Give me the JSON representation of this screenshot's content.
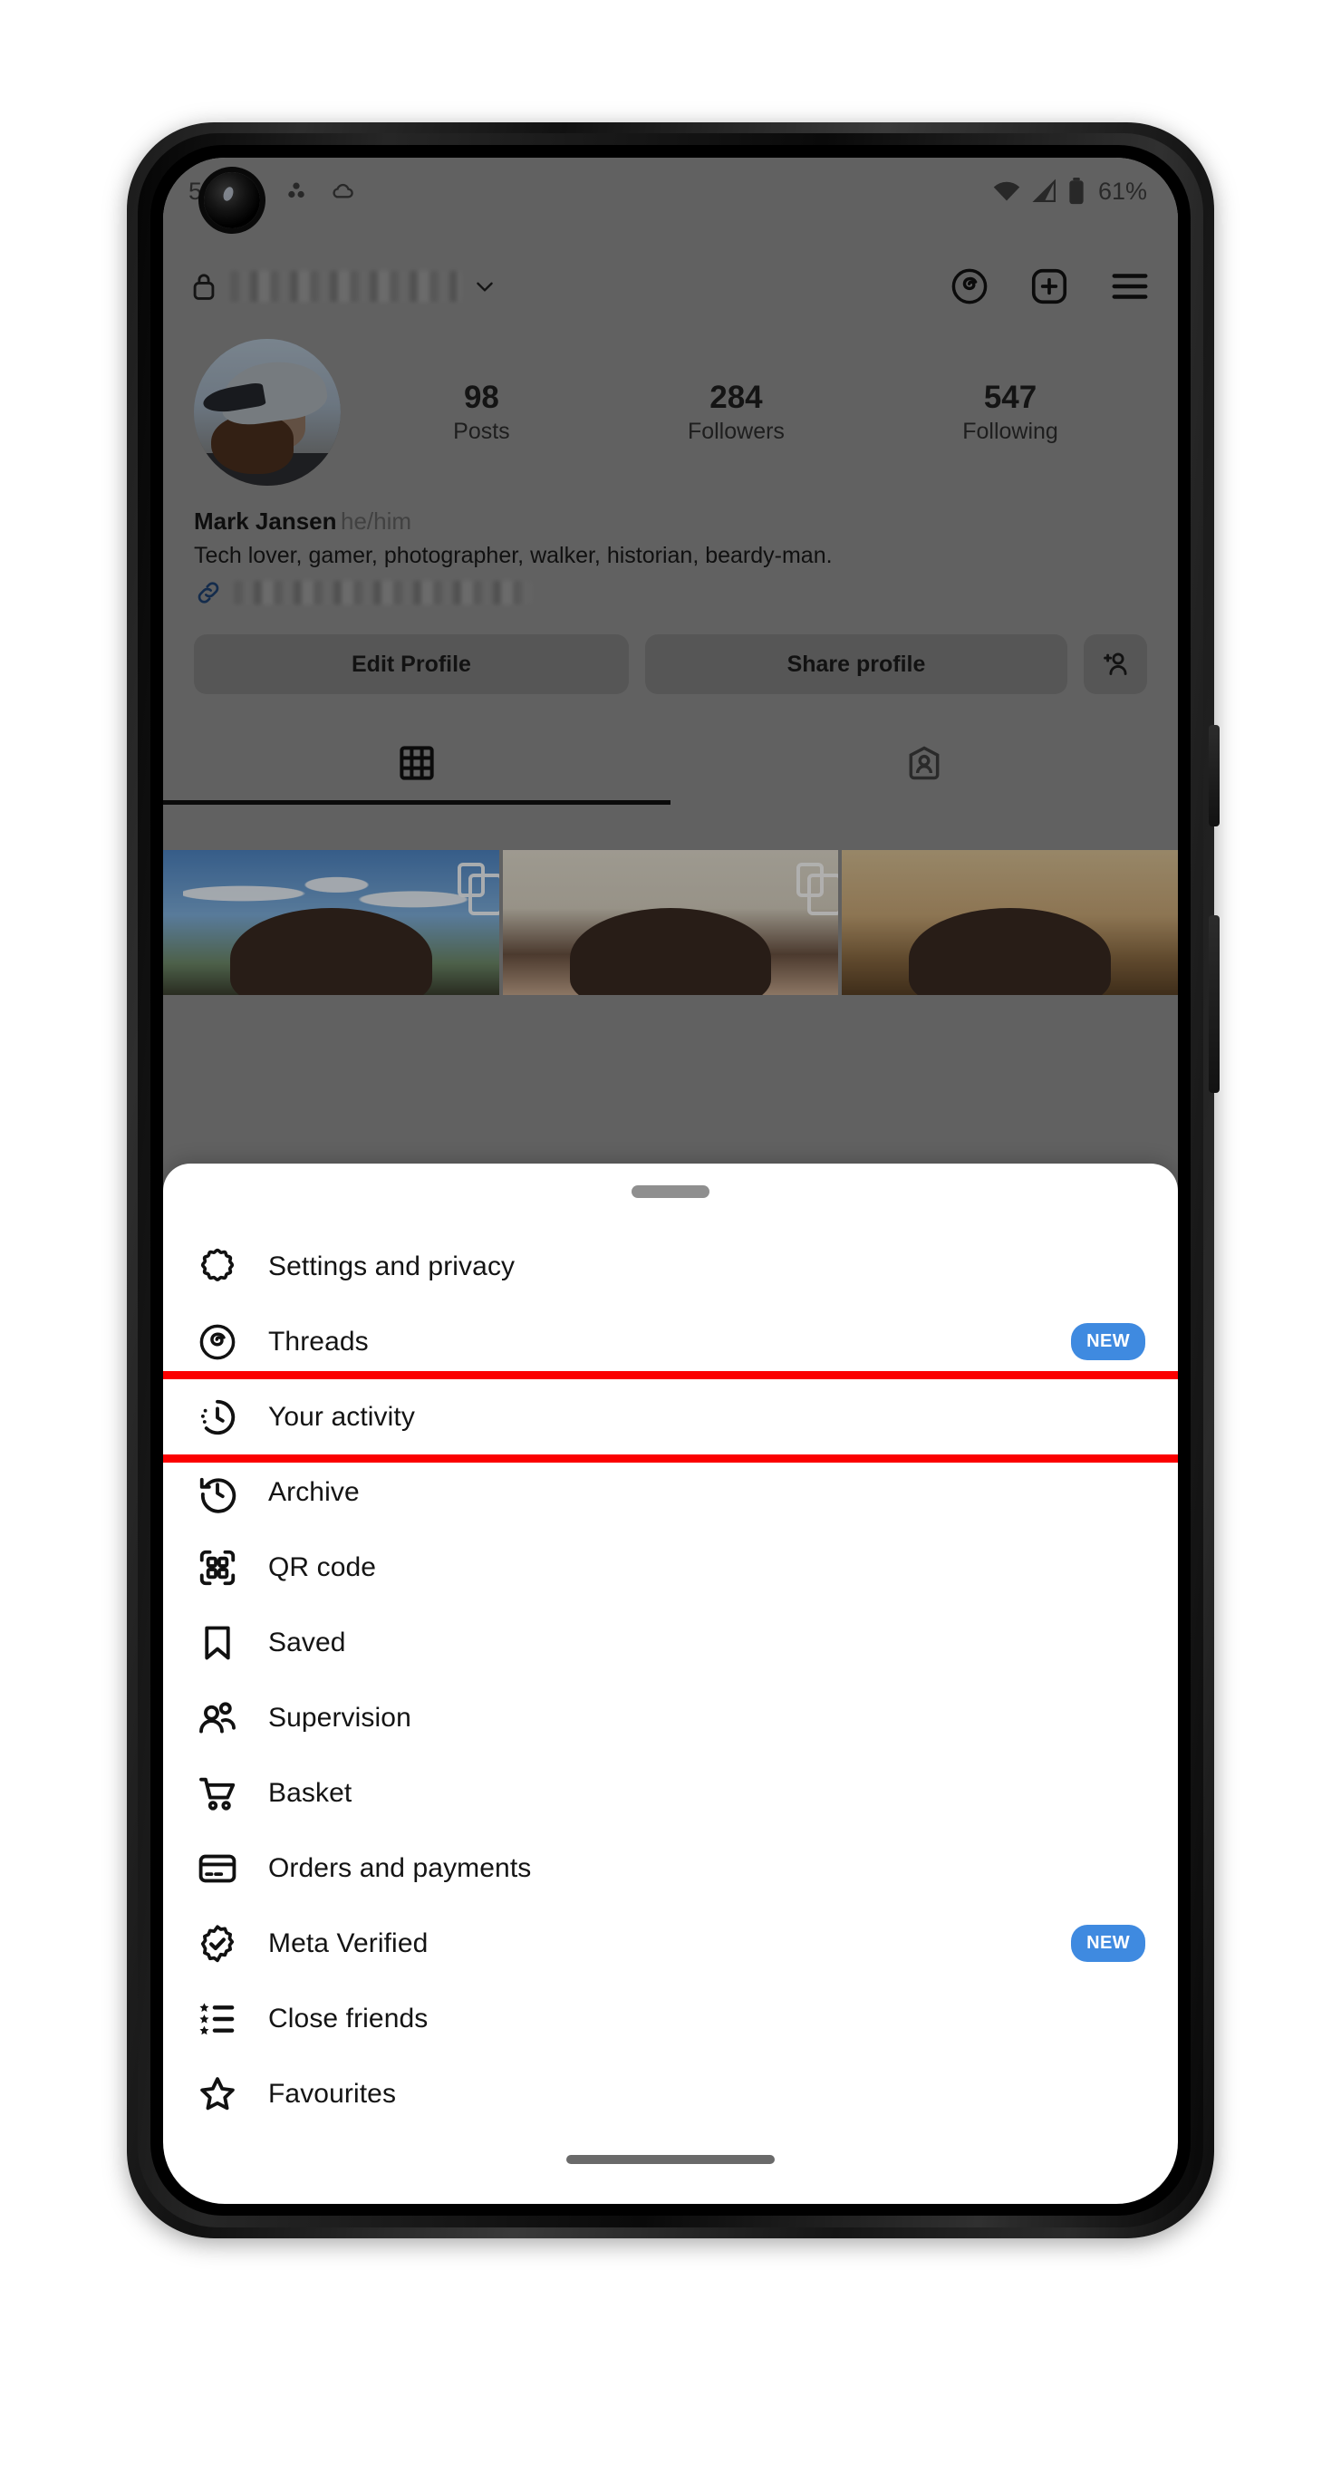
{
  "statusbar": {
    "time": "50",
    "battery_percent": "61%",
    "icons": [
      "leaf-icon",
      "dots-icon",
      "cloud-icon",
      "wifi-icon",
      "signal-icon",
      "battery-icon"
    ]
  },
  "header": {
    "lock_icon": "lock-icon",
    "username": "",
    "username_redacted": true,
    "chevron": "chevron-down-icon",
    "threads_icon": "threads-icon",
    "create_icon": "plus-box-icon",
    "menu_icon": "hamburger-menu-icon"
  },
  "profile": {
    "stats": [
      {
        "count": "98",
        "label": "Posts"
      },
      {
        "count": "284",
        "label": "Followers"
      },
      {
        "count": "547",
        "label": "Following"
      }
    ],
    "name": "Mark Jansen",
    "pronouns": "he/him",
    "bio": "Tech lover, gamer, photographer, walker, historian, beardy-man.",
    "link_redacted": true,
    "buttons": {
      "edit_profile": "Edit Profile",
      "share_profile": "Share profile",
      "add_person": "add-person-icon"
    },
    "tabs": [
      {
        "name": "grid-tab",
        "icon": "grid-icon",
        "active": true
      },
      {
        "name": "tagged-tab",
        "icon": "tagged-person-icon",
        "active": false
      }
    ]
  },
  "sheet": {
    "handle": "drag-handle",
    "items": [
      {
        "label": "Settings and privacy",
        "icon": "settings-gear-icon",
        "badge": "",
        "highlighted": false
      },
      {
        "label": "Threads",
        "icon": "threads-icon",
        "badge": "NEW",
        "highlighted": false
      },
      {
        "label": "Your activity",
        "icon": "your-activity-clock-icon",
        "badge": "",
        "highlighted": true
      },
      {
        "label": "Archive",
        "icon": "archive-clock-back-icon",
        "badge": "",
        "highlighted": false
      },
      {
        "label": "QR code",
        "icon": "qr-code-icon",
        "badge": "",
        "highlighted": false
      },
      {
        "label": "Saved",
        "icon": "bookmark-icon",
        "badge": "",
        "highlighted": false
      },
      {
        "label": "Supervision",
        "icon": "supervision-people-icon",
        "badge": "",
        "highlighted": false
      },
      {
        "label": "Basket",
        "icon": "shopping-cart-icon",
        "badge": "",
        "highlighted": false
      },
      {
        "label": "Orders and payments",
        "icon": "credit-card-icon",
        "badge": "",
        "highlighted": false
      },
      {
        "label": "Meta Verified",
        "icon": "verified-badge-icon",
        "badge": "NEW",
        "highlighted": false
      },
      {
        "label": "Close friends",
        "icon": "star-list-icon",
        "badge": "",
        "highlighted": false
      },
      {
        "label": "Favourites",
        "icon": "star-outline-icon",
        "badge": "",
        "highlighted": false
      }
    ]
  },
  "colors": {
    "highlight": "#fb0000",
    "badge_new": "#3f8ae0",
    "sheet_bg": "#ffffff",
    "dim_overlay": "rgba(0,0,0,0.30)"
  }
}
